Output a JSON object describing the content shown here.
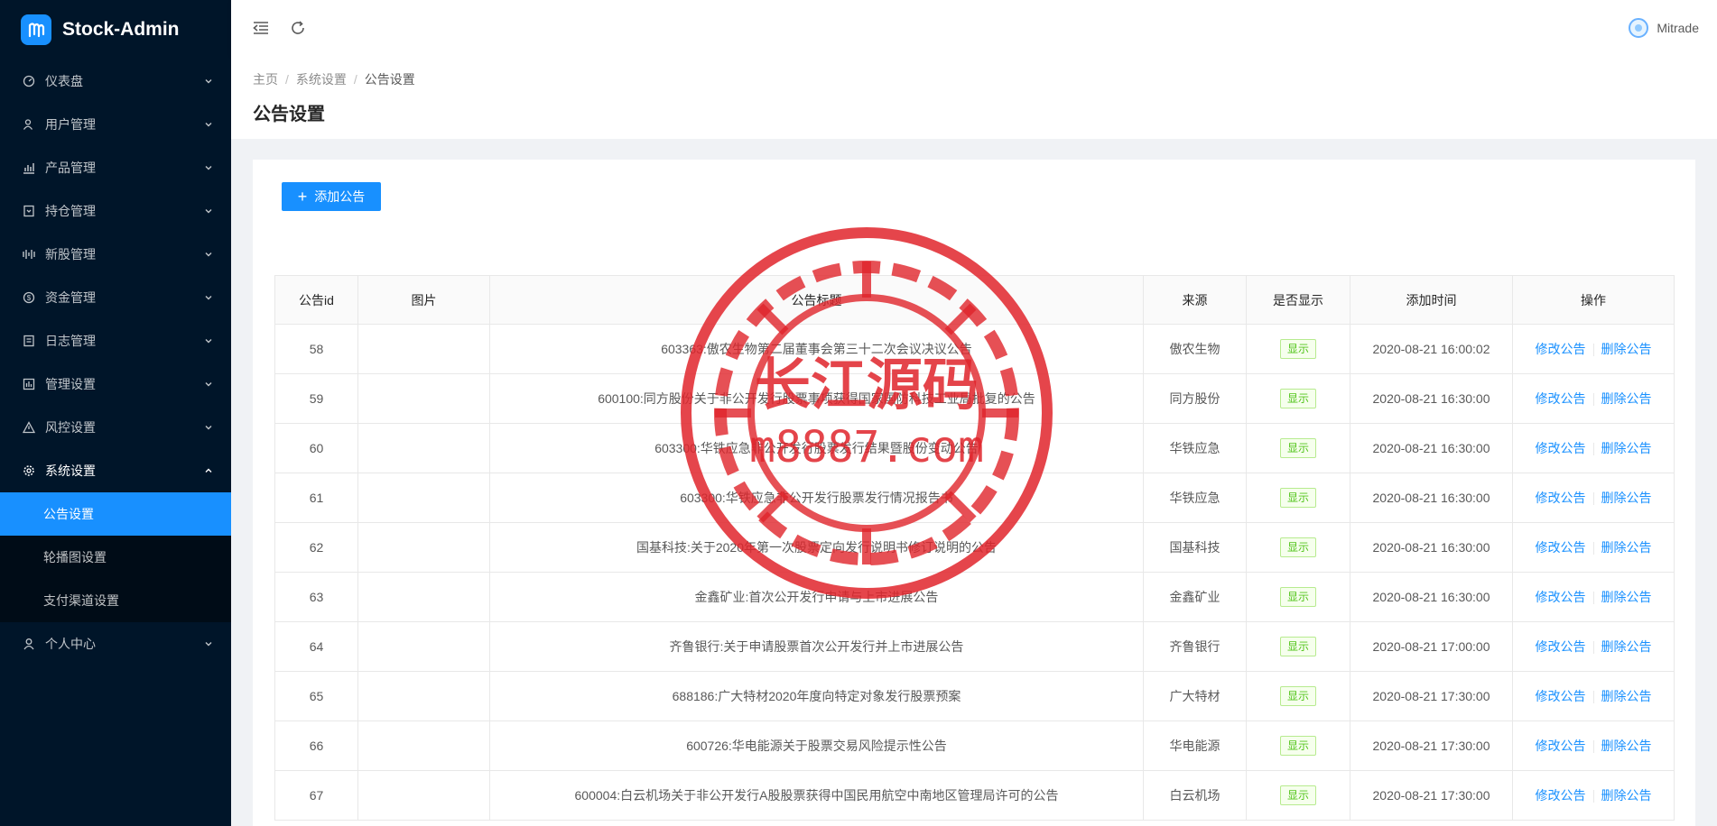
{
  "brand": {
    "title": "Stock-Admin"
  },
  "sidebar": {
    "items": [
      {
        "label": "仪表盘",
        "icon": "dashboard-icon"
      },
      {
        "label": "用户管理",
        "icon": "user-manage-icon"
      },
      {
        "label": "产品管理",
        "icon": "chart-icon"
      },
      {
        "label": "持仓管理",
        "icon": "position-icon"
      },
      {
        "label": "新股管理",
        "icon": "ipo-icon"
      },
      {
        "label": "资金管理",
        "icon": "money-icon"
      },
      {
        "label": "日志管理",
        "icon": "log-icon"
      },
      {
        "label": "管理设置",
        "icon": "admin-settings-icon"
      },
      {
        "label": "风控设置",
        "icon": "warning-icon"
      },
      {
        "label": "系统设置",
        "icon": "gear-icon"
      }
    ],
    "submenu": [
      "公告设置",
      "轮播图设置",
      "支付渠道设置"
    ],
    "personal": {
      "label": "个人中心",
      "icon": "person-icon"
    }
  },
  "header": {
    "username": "Mitrade"
  },
  "breadcrumb": {
    "home": "主页",
    "parent": "系统设置",
    "current": "公告设置"
  },
  "page": {
    "title": "公告设置",
    "add_button": "添加公告"
  },
  "table": {
    "columns": [
      "公告id",
      "图片",
      "公告标题",
      "来源",
      "是否显示",
      "添加时间",
      "操作"
    ],
    "rows": [
      {
        "id": "58",
        "title": "603363:傲农生物第二届董事会第三十二次会议决议公告",
        "source": "傲农生物",
        "status": "显示",
        "time": "2020-08-21 16:00:02"
      },
      {
        "id": "59",
        "title": "600100:同方股份关于非公开发行股票事项获得国家国防科技工业局批复的公告",
        "source": "同方股份",
        "status": "显示",
        "time": "2020-08-21 16:30:00"
      },
      {
        "id": "60",
        "title": "603300:华铁应急非公开发行股票发行结果暨股份变动公告",
        "source": "华铁应急",
        "status": "显示",
        "time": "2020-08-21 16:30:00"
      },
      {
        "id": "61",
        "title": "603300:华铁应急非公开发行股票发行情况报告书",
        "source": "华铁应急",
        "status": "显示",
        "time": "2020-08-21 16:30:00"
      },
      {
        "id": "62",
        "title": "国基科技:关于2020年第一次股票定向发行说明书修订说明的公告",
        "source": "国基科技",
        "status": "显示",
        "time": "2020-08-21 16:30:00"
      },
      {
        "id": "63",
        "title": "金鑫矿业:首次公开发行申请与上市进展公告",
        "source": "金鑫矿业",
        "status": "显示",
        "time": "2020-08-21 16:30:00"
      },
      {
        "id": "64",
        "title": "齐鲁银行:关于申请股票首次公开发行并上市进展公告",
        "source": "齐鲁银行",
        "status": "显示",
        "time": "2020-08-21 17:00:00"
      },
      {
        "id": "65",
        "title": "688186:广大特材2020年度向特定对象发行股票预案",
        "source": "广大特材",
        "status": "显示",
        "time": "2020-08-21 17:30:00"
      },
      {
        "id": "66",
        "title": "600726:华电能源关于股票交易风险提示性公告",
        "source": "华电能源",
        "status": "显示",
        "time": "2020-08-21 17:30:00"
      },
      {
        "id": "67",
        "title": "600004:白云机场关于非公开发行A股股票获得中国民用航空中南地区管理局许可的公告",
        "source": "白云机场",
        "status": "显示",
        "time": "2020-08-21 17:30:00"
      }
    ],
    "edit_label": "修改公告",
    "delete_label": "删除公告"
  },
  "watermark": {
    "name": "长江源码",
    "domain": "m8887.com",
    "color": "#e0242b"
  }
}
